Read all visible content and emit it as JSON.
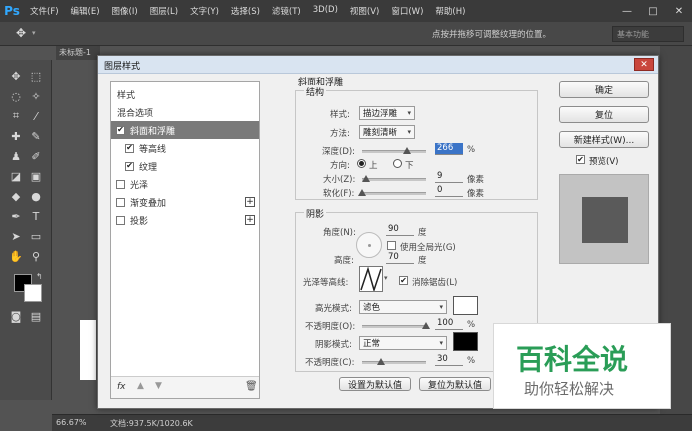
{
  "app": {
    "logo": "Ps"
  },
  "menu": [
    "文件(F)",
    "编辑(E)",
    "图像(I)",
    "图层(L)",
    "文字(Y)",
    "选择(S)",
    "滤镜(T)",
    "3D(D)",
    "视图(V)",
    "窗口(W)",
    "帮助(H)"
  ],
  "options_bar": {
    "hint": "点按并拖移可调整纹理的位置。",
    "workspace": "基本功能"
  },
  "document": {
    "tab": "未标题-1",
    "zoom": "66.67%",
    "doc_size": "文档:937.5K/1020.6K"
  },
  "dialog": {
    "title": "图层样式",
    "styles_list": {
      "header": "样式",
      "blend_options": "混合选项",
      "items": [
        {
          "label": "斜面和浮雕",
          "checked": true,
          "selected": true
        },
        {
          "label": "等高线",
          "checked": true,
          "indent": true
        },
        {
          "label": "纹理",
          "checked": true,
          "indent": true
        },
        {
          "label": "光泽",
          "checked": false
        },
        {
          "label": "渐变叠加",
          "checked": false,
          "plus": true
        },
        {
          "label": "投影",
          "checked": false,
          "plus": true
        }
      ],
      "fx": "fx"
    },
    "bevel": {
      "section_title": "斜面和浮雕",
      "structure_title": "结构",
      "style_label": "样式:",
      "style_value": "描边浮雕",
      "technique_label": "方法:",
      "technique_value": "雕刻清晰",
      "depth_label": "深度(D):",
      "depth_value": "266",
      "depth_unit": "%",
      "depth_pct": 0.7,
      "direction_label": "方向:",
      "direction_up": "上",
      "direction_down": "下",
      "size_label": "大小(Z):",
      "size_value": "9",
      "size_unit": "像素",
      "size_pct": 0.06,
      "soften_label": "软化(F):",
      "soften_value": "0",
      "soften_unit": "像素",
      "soften_pct": 0.0
    },
    "shading": {
      "title": "阴影",
      "angle_label": "角度(N):",
      "angle_value": "90",
      "angle_unit": "度",
      "global_light": "使用全局光(G)",
      "altitude_label": "高度:",
      "altitude_value": "70",
      "altitude_unit": "度",
      "gloss_label": "光泽等高线:",
      "anti_alias": "消除锯齿(L)",
      "highlight_label": "高光模式:",
      "highlight_mode": "滤色",
      "highlight_color": "#ffffff",
      "highlight_opacity_label": "不透明度(O):",
      "highlight_opacity": "100",
      "highlight_opacity_pct": 1.0,
      "shadow_label": "阴影模式:",
      "shadow_mode": "正常",
      "shadow_color": "#000000",
      "shadow_opacity_label": "不透明度(C):",
      "shadow_opacity": "30",
      "shadow_opacity_pct": 0.3,
      "pct": "%"
    },
    "buttons": {
      "ok": "确定",
      "reset": "复位",
      "new_style": "新建样式(W)...",
      "preview": "预览(V)",
      "make_default": "设置为默认值",
      "reset_default": "复位为默认值"
    }
  },
  "watermark": {
    "title": "百科全说",
    "subtitle": "助你轻松解决"
  }
}
